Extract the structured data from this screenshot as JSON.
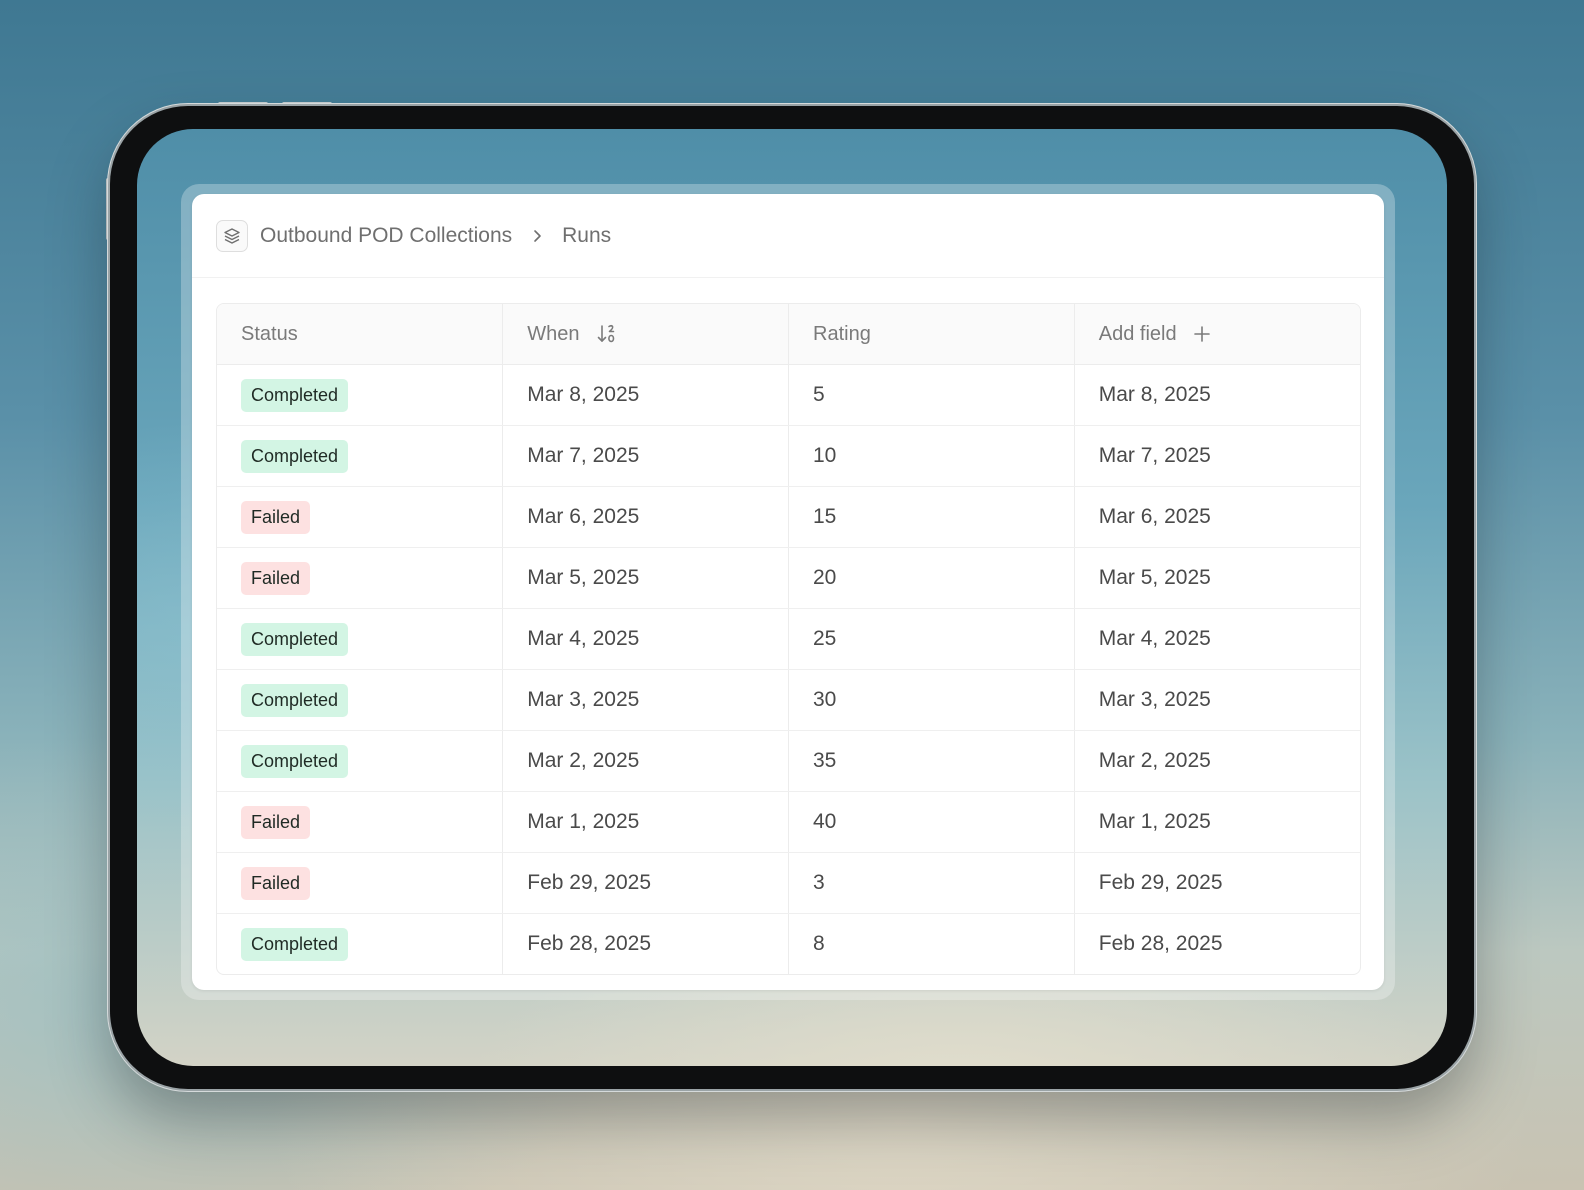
{
  "breadcrumb": {
    "icon": "layers-icon",
    "parent": "Outbound POD Collections",
    "separator_icon": "chevron-right-icon",
    "current": "Runs"
  },
  "table": {
    "columns": [
      {
        "label": "Status"
      },
      {
        "label": "When",
        "icon": "sort-descending-icon"
      },
      {
        "label": "Rating"
      },
      {
        "label": "Add field",
        "icon": "plus-icon"
      }
    ],
    "rows": [
      {
        "status": "Completed",
        "status_type": "completed",
        "when": "Mar 8, 2025",
        "rating": "5",
        "field": "Mar 8, 2025"
      },
      {
        "status": "Completed",
        "status_type": "completed",
        "when": "Mar 7, 2025",
        "rating": "10",
        "field": "Mar 7, 2025"
      },
      {
        "status": "Failed",
        "status_type": "failed",
        "when": "Mar 6, 2025",
        "rating": "15",
        "field": "Mar 6, 2025"
      },
      {
        "status": "Failed",
        "status_type": "failed",
        "when": "Mar 5, 2025",
        "rating": "20",
        "field": "Mar 5, 2025"
      },
      {
        "status": "Completed",
        "status_type": "completed",
        "when": "Mar 4, 2025",
        "rating": "25",
        "field": "Mar 4, 2025"
      },
      {
        "status": "Completed",
        "status_type": "completed",
        "when": "Mar 3, 2025",
        "rating": "30",
        "field": "Mar 3, 2025"
      },
      {
        "status": "Completed",
        "status_type": "completed",
        "when": "Mar 2, 2025",
        "rating": "35",
        "field": "Mar 2, 2025"
      },
      {
        "status": "Failed",
        "status_type": "failed",
        "when": "Mar 1, 2025",
        "rating": "40",
        "field": "Mar 1, 2025"
      },
      {
        "status": "Failed",
        "status_type": "failed",
        "when": "Feb 29, 2025",
        "rating": "3",
        "field": "Feb 29, 2025"
      },
      {
        "status": "Completed",
        "status_type": "completed",
        "when": "Feb 28, 2025",
        "rating": "8",
        "field": "Feb 28, 2025"
      }
    ]
  },
  "colors": {
    "completed_badge": "#d3f5e4",
    "failed_badge": "#fde1e1"
  }
}
